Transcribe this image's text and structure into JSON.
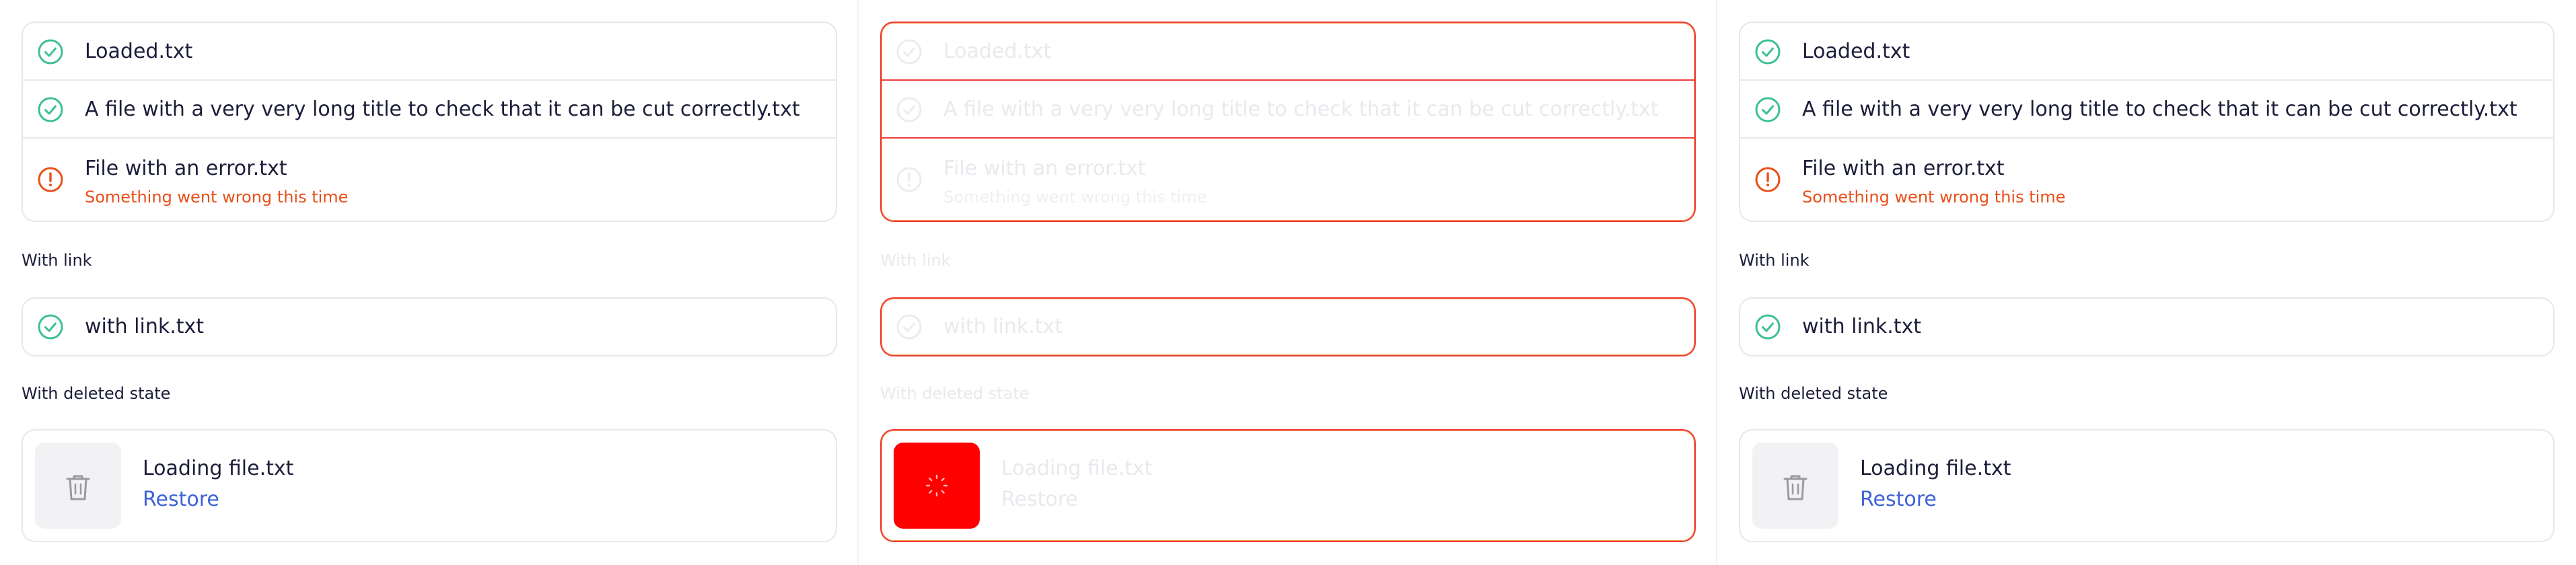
{
  "panels": [
    {
      "files": [
        {
          "name": "Loaded.txt",
          "status": "success",
          "icon": "check-circle-icon"
        },
        {
          "name": "A file with a very very long title to check that it can be cut correctly.txt",
          "status": "success",
          "icon": "check-circle-icon"
        },
        {
          "name": "File with an error.txt",
          "status": "error",
          "icon": "alert-circle-icon",
          "error": "Something went wrong this time"
        }
      ],
      "with_link_label": "With link",
      "link_file": {
        "name": "with link.txt",
        "icon": "check-circle-icon"
      },
      "with_deleted_label": "With deleted state",
      "deleted_file": {
        "name": "Loading file.txt",
        "restore_label": "Restore",
        "icon": "trash-icon"
      }
    },
    {
      "files": [
        {
          "name": "Loaded.txt",
          "status": "success",
          "icon": "check-circle-icon"
        },
        {
          "name": "A file with a very very long title to check that it can be cut correctly.txt",
          "status": "success",
          "icon": "check-circle-icon"
        },
        {
          "name": "File with an error.txt",
          "status": "error",
          "icon": "alert-circle-icon",
          "error": "Something went wrong this time"
        }
      ],
      "with_link_label": "With link",
      "link_file": {
        "name": "with link.txt",
        "icon": "check-circle-icon"
      },
      "with_deleted_label": "With deleted state",
      "deleted_file": {
        "name": "Loading file.txt",
        "restore_label": "Restore",
        "icon": "loading-spinner-icon"
      }
    },
    {
      "files": [
        {
          "name": "Loaded.txt",
          "status": "success",
          "icon": "check-circle-icon"
        },
        {
          "name": "A file with a very very long title to check that it can be cut correctly.txt",
          "status": "success",
          "icon": "check-circle-icon"
        },
        {
          "name": "File with an error.txt",
          "status": "error",
          "icon": "alert-circle-icon",
          "error": "Something went wrong this time"
        }
      ],
      "with_link_label": "With link",
      "link_file": {
        "name": "with link.txt",
        "icon": "check-circle-icon"
      },
      "with_deleted_label": "With deleted state",
      "deleted_file": {
        "name": "Loading file.txt",
        "restore_label": "Restore",
        "icon": "trash-icon"
      }
    }
  ],
  "colors": {
    "success": "#3dbf98",
    "error": "#ea4f1a",
    "link": "#3d63d6",
    "border": "#e6e7ee",
    "disabled_outline": "#ee3b3b",
    "disabled_text": "#e9e9ee",
    "thumb_bg": "#f2f2f4",
    "thumb_active": "#ff0000"
  }
}
